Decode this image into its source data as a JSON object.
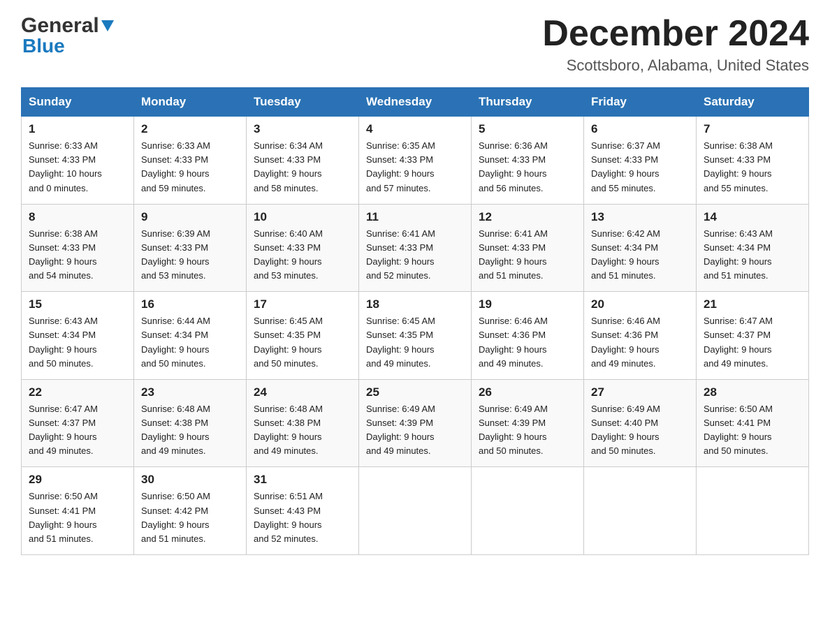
{
  "header": {
    "logo_general": "General",
    "logo_blue": "Blue",
    "title": "December 2024",
    "location": "Scottsboro, Alabama, United States"
  },
  "days_of_week": [
    "Sunday",
    "Monday",
    "Tuesday",
    "Wednesday",
    "Thursday",
    "Friday",
    "Saturday"
  ],
  "weeks": [
    [
      {
        "day": "1",
        "sunrise": "6:33 AM",
        "sunset": "4:33 PM",
        "daylight": "10 hours and 0 minutes."
      },
      {
        "day": "2",
        "sunrise": "6:33 AM",
        "sunset": "4:33 PM",
        "daylight": "9 hours and 59 minutes."
      },
      {
        "day": "3",
        "sunrise": "6:34 AM",
        "sunset": "4:33 PM",
        "daylight": "9 hours and 58 minutes."
      },
      {
        "day": "4",
        "sunrise": "6:35 AM",
        "sunset": "4:33 PM",
        "daylight": "9 hours and 57 minutes."
      },
      {
        "day": "5",
        "sunrise": "6:36 AM",
        "sunset": "4:33 PM",
        "daylight": "9 hours and 56 minutes."
      },
      {
        "day": "6",
        "sunrise": "6:37 AM",
        "sunset": "4:33 PM",
        "daylight": "9 hours and 55 minutes."
      },
      {
        "day": "7",
        "sunrise": "6:38 AM",
        "sunset": "4:33 PM",
        "daylight": "9 hours and 55 minutes."
      }
    ],
    [
      {
        "day": "8",
        "sunrise": "6:38 AM",
        "sunset": "4:33 PM",
        "daylight": "9 hours and 54 minutes."
      },
      {
        "day": "9",
        "sunrise": "6:39 AM",
        "sunset": "4:33 PM",
        "daylight": "9 hours and 53 minutes."
      },
      {
        "day": "10",
        "sunrise": "6:40 AM",
        "sunset": "4:33 PM",
        "daylight": "9 hours and 53 minutes."
      },
      {
        "day": "11",
        "sunrise": "6:41 AM",
        "sunset": "4:33 PM",
        "daylight": "9 hours and 52 minutes."
      },
      {
        "day": "12",
        "sunrise": "6:41 AM",
        "sunset": "4:33 PM",
        "daylight": "9 hours and 51 minutes."
      },
      {
        "day": "13",
        "sunrise": "6:42 AM",
        "sunset": "4:34 PM",
        "daylight": "9 hours and 51 minutes."
      },
      {
        "day": "14",
        "sunrise": "6:43 AM",
        "sunset": "4:34 PM",
        "daylight": "9 hours and 51 minutes."
      }
    ],
    [
      {
        "day": "15",
        "sunrise": "6:43 AM",
        "sunset": "4:34 PM",
        "daylight": "9 hours and 50 minutes."
      },
      {
        "day": "16",
        "sunrise": "6:44 AM",
        "sunset": "4:34 PM",
        "daylight": "9 hours and 50 minutes."
      },
      {
        "day": "17",
        "sunrise": "6:45 AM",
        "sunset": "4:35 PM",
        "daylight": "9 hours and 50 minutes."
      },
      {
        "day": "18",
        "sunrise": "6:45 AM",
        "sunset": "4:35 PM",
        "daylight": "9 hours and 49 minutes."
      },
      {
        "day": "19",
        "sunrise": "6:46 AM",
        "sunset": "4:36 PM",
        "daylight": "9 hours and 49 minutes."
      },
      {
        "day": "20",
        "sunrise": "6:46 AM",
        "sunset": "4:36 PM",
        "daylight": "9 hours and 49 minutes."
      },
      {
        "day": "21",
        "sunrise": "6:47 AM",
        "sunset": "4:37 PM",
        "daylight": "9 hours and 49 minutes."
      }
    ],
    [
      {
        "day": "22",
        "sunrise": "6:47 AM",
        "sunset": "4:37 PM",
        "daylight": "9 hours and 49 minutes."
      },
      {
        "day": "23",
        "sunrise": "6:48 AM",
        "sunset": "4:38 PM",
        "daylight": "9 hours and 49 minutes."
      },
      {
        "day": "24",
        "sunrise": "6:48 AM",
        "sunset": "4:38 PM",
        "daylight": "9 hours and 49 minutes."
      },
      {
        "day": "25",
        "sunrise": "6:49 AM",
        "sunset": "4:39 PM",
        "daylight": "9 hours and 49 minutes."
      },
      {
        "day": "26",
        "sunrise": "6:49 AM",
        "sunset": "4:39 PM",
        "daylight": "9 hours and 50 minutes."
      },
      {
        "day": "27",
        "sunrise": "6:49 AM",
        "sunset": "4:40 PM",
        "daylight": "9 hours and 50 minutes."
      },
      {
        "day": "28",
        "sunrise": "6:50 AM",
        "sunset": "4:41 PM",
        "daylight": "9 hours and 50 minutes."
      }
    ],
    [
      {
        "day": "29",
        "sunrise": "6:50 AM",
        "sunset": "4:41 PM",
        "daylight": "9 hours and 51 minutes."
      },
      {
        "day": "30",
        "sunrise": "6:50 AM",
        "sunset": "4:42 PM",
        "daylight": "9 hours and 51 minutes."
      },
      {
        "day": "31",
        "sunrise": "6:51 AM",
        "sunset": "4:43 PM",
        "daylight": "9 hours and 52 minutes."
      },
      null,
      null,
      null,
      null
    ]
  ],
  "labels": {
    "sunrise": "Sunrise:",
    "sunset": "Sunset:",
    "daylight": "Daylight:"
  }
}
